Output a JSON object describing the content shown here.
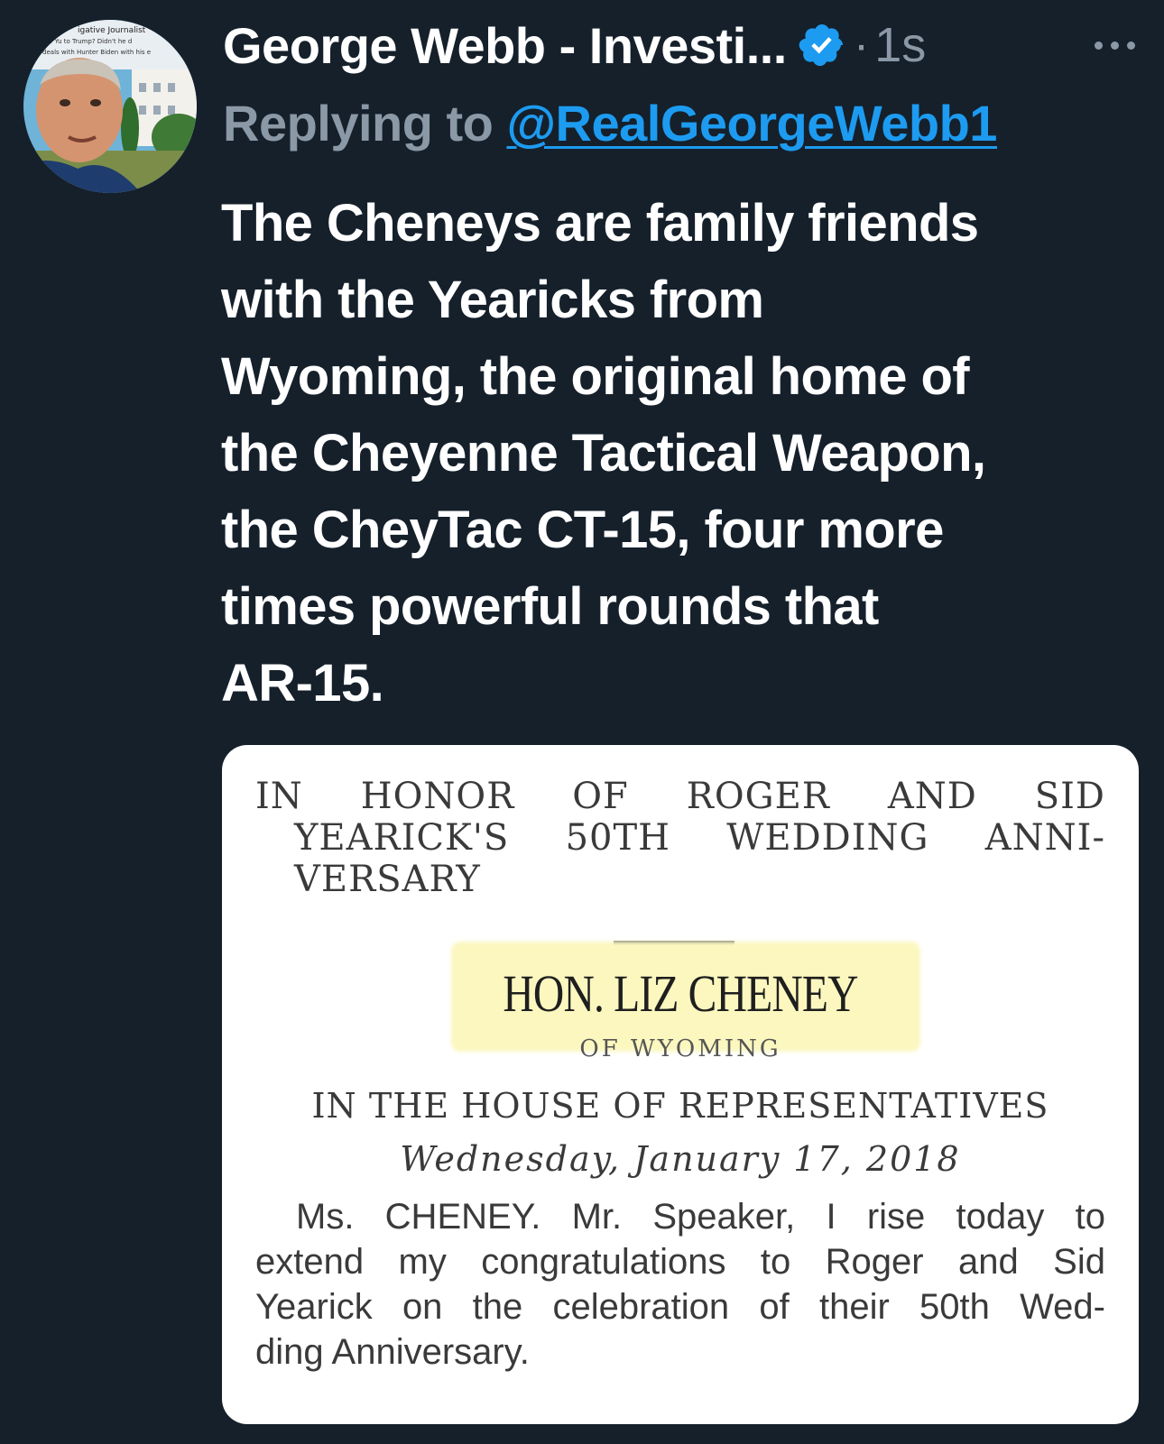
{
  "tweet": {
    "display_name": "George Webb - Investi...",
    "time_separator": "·",
    "time": "1s",
    "reply_prefix": "Replying to ",
    "reply_handle": "@RealGeorgeWebb1",
    "text_lines": [
      "The Cheneys are family friends",
      "with the Yearicks from",
      "Wyoming, the original home of",
      "the Cheyenne Tactical Weapon,",
      "the CheyTac CT-15, four more",
      "times powerful rounds that",
      "AR-15."
    ]
  },
  "avatar": {
    "tiny_text_lines": [
      "igative Journalist",
      "ame of Yu to Trump? Didn't he d",
      "pens deals with Hunter Biden with his e"
    ]
  },
  "icons": {
    "verified": "verified-badge-icon",
    "more": "more-options-icon"
  },
  "colors": {
    "background": "#15202b",
    "text_primary": "#ffffff",
    "text_secondary": "#8b98a5",
    "accent": "#1d9bf0",
    "highlight": "#fbf7bf"
  },
  "clipping": {
    "title_lines": [
      [
        "IN",
        "HONOR",
        "OF",
        "ROGER",
        "AND",
        "SID"
      ],
      [
        "YEARICK'S",
        "50TH",
        "WEDDING",
        "ANNI-"
      ],
      [
        "VERSARY"
      ]
    ],
    "honoree": "HON. LIZ CHENEY",
    "state": "OF WYOMING",
    "chamber": "IN THE HOUSE OF REPRESENTATIVES",
    "date": "Wednesday, January 17, 2018",
    "body_lines": [
      [
        "Ms.",
        "CHENEY.",
        "Mr.",
        "Speaker,",
        "I",
        "rise",
        "today",
        "to"
      ],
      [
        "extend",
        "my",
        "congratulations",
        "to",
        "Roger",
        "and",
        "Sid"
      ],
      [
        "Yearick",
        "on",
        "the",
        "celebration",
        "of",
        "their",
        "50th",
        "Wed-"
      ],
      [
        "ding Anniversary."
      ]
    ]
  }
}
